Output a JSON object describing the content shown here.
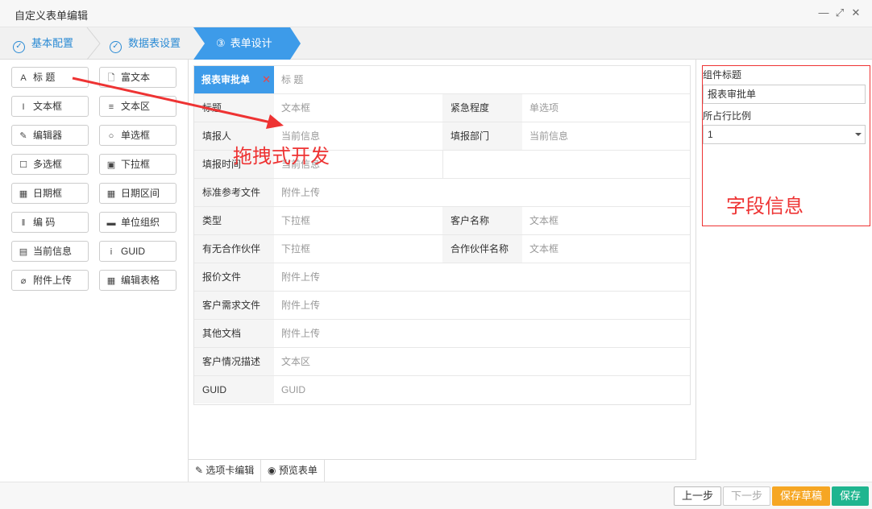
{
  "window": {
    "title": "自定义表单编辑",
    "controls": [
      "minimize-icon",
      "maximize-icon",
      "close-icon"
    ]
  },
  "steps": [
    {
      "label": "基本配置",
      "state": "done"
    },
    {
      "label": "数据表设置",
      "state": "done"
    },
    {
      "label": "表单设计",
      "state": "active",
      "number": "③"
    }
  ],
  "toolbox": [
    {
      "label": "标 题",
      "icon": "font-icon",
      "glyph": "A"
    },
    {
      "label": "富文本",
      "icon": "document-icon",
      "glyph": "🗋"
    },
    {
      "label": "文本框",
      "icon": "italic-cursor-icon",
      "glyph": "I"
    },
    {
      "label": "文本区",
      "icon": "lines-icon",
      "glyph": "≡"
    },
    {
      "label": "编辑器",
      "icon": "edit-icon",
      "glyph": "✎"
    },
    {
      "label": "单选框",
      "icon": "radio-icon",
      "glyph": "○"
    },
    {
      "label": "多选框",
      "icon": "checkbox-icon",
      "glyph": "☐"
    },
    {
      "label": "下拉框",
      "icon": "dropdown-icon",
      "glyph": "▣"
    },
    {
      "label": "日期框",
      "icon": "calendar-icon",
      "glyph": "▦"
    },
    {
      "label": "日期区间",
      "icon": "calendar-range-icon",
      "glyph": "▦"
    },
    {
      "label": "编 码",
      "icon": "barcode-icon",
      "glyph": "‖"
    },
    {
      "label": "单位组织",
      "icon": "organization-icon",
      "glyph": "▬"
    },
    {
      "label": "当前信息",
      "icon": "info-card-icon",
      "glyph": "▤"
    },
    {
      "label": "GUID",
      "icon": "info-icon",
      "glyph": "i"
    },
    {
      "label": "附件上传",
      "icon": "paperclip-icon",
      "glyph": "⌀"
    },
    {
      "label": "编辑表格",
      "icon": "table-icon",
      "glyph": "▦"
    }
  ],
  "form": {
    "selected_title": "报表审批单",
    "title_placeholder": "标 题",
    "rows": [
      [
        {
          "label": "标题",
          "value": "文本框"
        },
        {
          "label": "紧急程度",
          "value": "单选项"
        }
      ],
      [
        {
          "label": "填报人",
          "value": "当前信息"
        },
        {
          "label": "填报部门",
          "value": "当前信息"
        }
      ],
      [
        {
          "label": "填报时间",
          "value": "当前信息"
        }
      ],
      [
        {
          "label": "标准参考文件",
          "value": "附件上传",
          "full": true
        }
      ],
      [
        {
          "label": "类型",
          "value": "下拉框"
        },
        {
          "label": "客户名称",
          "value": "文本框"
        }
      ],
      [
        {
          "label": "有无合作伙伴",
          "value": "下拉框"
        },
        {
          "label": "合作伙伴名称",
          "value": "文本框"
        }
      ],
      [
        {
          "label": "报价文件",
          "value": "附件上传",
          "full": true
        }
      ],
      [
        {
          "label": "客户需求文件",
          "value": "附件上传",
          "full": true
        }
      ],
      [
        {
          "label": "其他文档",
          "value": "附件上传",
          "full": true
        }
      ],
      [
        {
          "label": "客户情况描述",
          "value": "文本区",
          "full": true
        }
      ],
      [
        {
          "label": "GUID",
          "value": "GUID",
          "full": true
        }
      ]
    ]
  },
  "bottom_tabs": [
    {
      "label": "选项卡编辑",
      "icon": "edit-icon"
    },
    {
      "label": "预览表单",
      "icon": "eye-icon"
    }
  ],
  "properties": {
    "component_title_label": "组件标题",
    "component_title_value": "报表审批单",
    "ratio_label": "所占行比例",
    "ratio_value": "1"
  },
  "annotations": {
    "drag_note": "拖拽式开发",
    "field_info": "字段信息",
    "color": "#ee3333"
  },
  "footer": {
    "prev": "上一步",
    "next": "下一步",
    "save_draft": "保存草稿",
    "save": "保存"
  },
  "colors": {
    "accent": "#3d9be9",
    "orange": "#f6a623",
    "green": "#1fb58f"
  }
}
